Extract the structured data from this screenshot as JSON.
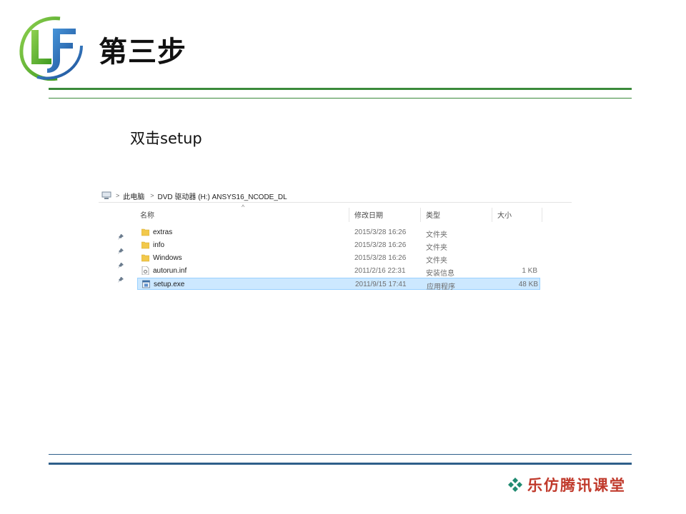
{
  "slide": {
    "title": "第三步",
    "instruction": "双击setup",
    "brand": "乐仿腾讯课堂"
  },
  "colors": {
    "logo_green": "#5ab52a",
    "logo_blue": "#2b6cb0",
    "top_rule": "#3a8a3a",
    "bottom_rule": "#2e5f8a",
    "brand_text": "#c0392b",
    "brand_mark": "#1f8a70",
    "selection_bg": "#cce8ff"
  },
  "explorer": {
    "breadcrumb": [
      "此电脑",
      "DVD 驱动器 (H:) ANSYS16_NCODE_DL"
    ],
    "columns": [
      "名称",
      "修改日期",
      "类型",
      "大小"
    ],
    "files": [
      {
        "name": "extras",
        "date": "2015/3/28 16:26",
        "type": "文件夹",
        "size": "",
        "icon": "folder-icon"
      },
      {
        "name": "info",
        "date": "2015/3/28 16:26",
        "type": "文件夹",
        "size": "",
        "icon": "folder-icon"
      },
      {
        "name": "Windows",
        "date": "2015/3/28 16:26",
        "type": "文件夹",
        "size": "",
        "icon": "folder-icon"
      },
      {
        "name": "autorun.inf",
        "date": "2011/2/16 22:31",
        "type": "安装信息",
        "size": "1 KB",
        "icon": "settings-file-icon"
      },
      {
        "name": "setup.exe",
        "date": "2011/9/15 17:41",
        "type": "应用程序",
        "size": "48 KB",
        "icon": "app-exe-icon",
        "selected": true
      }
    ]
  }
}
